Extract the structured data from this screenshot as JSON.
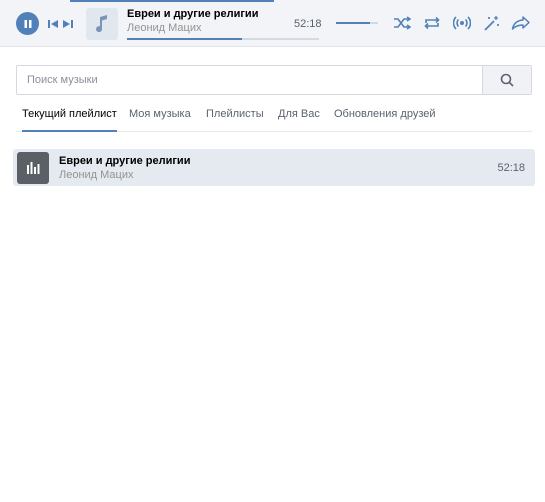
{
  "player": {
    "track_title": "Евреи и другие религии",
    "track_artist": "Леонид Мацих",
    "time": "52:18",
    "progress_fraction": 0.6,
    "volume_fraction": 0.8,
    "accent_color": "#5181b8",
    "icons": [
      "pause-icon",
      "prev-icon",
      "next-icon",
      "music-note-icon",
      "shuffle-icon",
      "repeat-icon",
      "broadcast-icon",
      "magic-wand-icon",
      "share-icon"
    ]
  },
  "search": {
    "placeholder": "Поиск музыки",
    "value": ""
  },
  "tabs": [
    {
      "label": "Текущий плейлист",
      "active": true
    },
    {
      "label": "Моя музыка",
      "active": false
    },
    {
      "label": "Плейлисты",
      "active": false
    },
    {
      "label": "Для Вас",
      "active": false
    },
    {
      "label": "Обновления друзей",
      "active": false
    }
  ],
  "playlist": [
    {
      "title": "Евреи и другие религии",
      "artist": "Леонид Мацих",
      "duration": "52:18",
      "playing": true
    }
  ]
}
